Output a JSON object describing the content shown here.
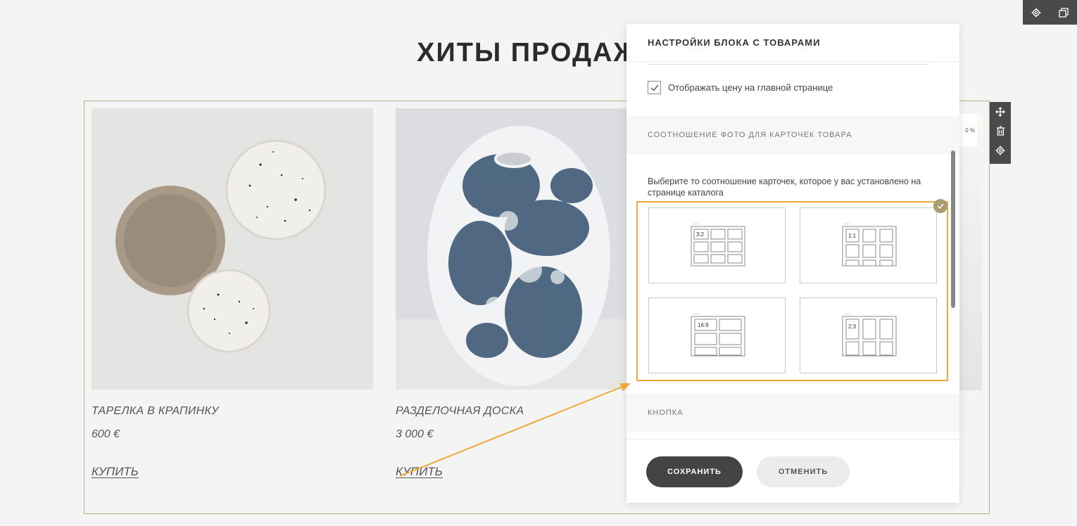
{
  "section": {
    "title": "ХИТЫ ПРОДАЖ"
  },
  "products": [
    {
      "name": "ТАРЕЛКА В КРАПИНКУ",
      "price": "600 €",
      "buy_label": "КУПИТЬ"
    },
    {
      "name": "РАЗДЕЛОЧНАЯ ДОСКА",
      "price": "3 000 €",
      "buy_label": "КУПИТЬ"
    }
  ],
  "peek_card": {
    "badge": "0 %"
  },
  "panel": {
    "title": "НАСТРОЙКИ БЛОКА С ТОВАРАМИ",
    "show_price_label": "Отображать цену на главной странице",
    "show_price_checked": true,
    "ratio_section_title": "СООТНОШЕНИЕ ФОТО ДЛЯ КАРТОЧЕК ТОВАРА",
    "ratio_helper": "Выберите то соотношение карточек, которое у вас установлено на странице каталога",
    "ratios": [
      {
        "label": "3:2",
        "selected": false
      },
      {
        "label": "1:1",
        "selected": true
      },
      {
        "label": "16:9",
        "selected": false
      },
      {
        "label": "2:3",
        "selected": false
      }
    ],
    "button_section_title": "КНОПКА",
    "save_label": "СОХРАНИТЬ",
    "cancel_label": "ОТМЕНИТЬ"
  },
  "colors": {
    "accent_highlight": "#f0a83a",
    "selected_badge": "#a89c74",
    "frame": "#b8ad8b",
    "save_button": "#444444"
  },
  "icons": {
    "top_toolbar": [
      "gear-icon",
      "copy-icon"
    ],
    "block_toolbar": [
      "move-icon",
      "trash-icon",
      "gear-icon"
    ],
    "selected": "check-icon"
  }
}
